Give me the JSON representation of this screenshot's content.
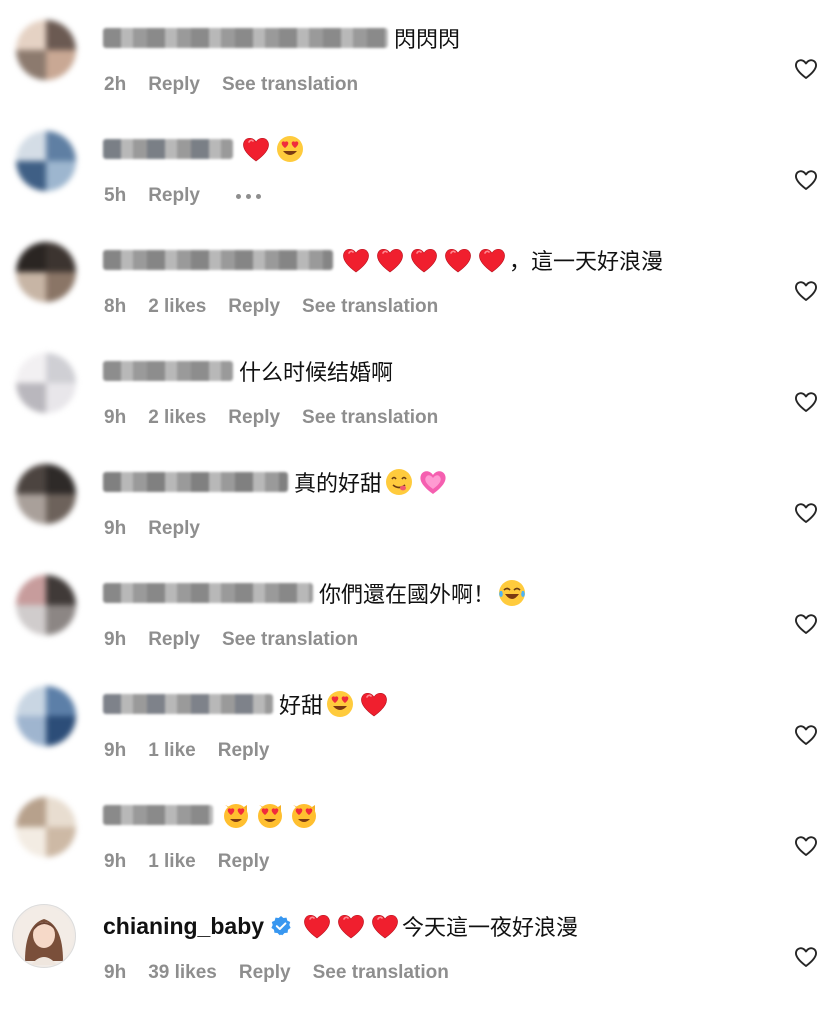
{
  "colors": {
    "meta_gray": "#8e8e8e",
    "text": "#111111",
    "heart_red": "#f01f2e",
    "verified_blue": "#3897f0"
  },
  "comments": [
    {
      "username": "",
      "username_blurred": true,
      "text_before": "閃閃閃",
      "emojis": [],
      "text_after": "",
      "time": "2h",
      "likes": "",
      "reply": "Reply",
      "translate": "See translation",
      "more": false,
      "like_icon": "heart-outline-icon"
    },
    {
      "username": "",
      "username_blurred": true,
      "text_before": "",
      "emojis": [
        "red-heart",
        "heart-eyes-face"
      ],
      "text_after": "",
      "time": "5h",
      "likes": "",
      "reply": "Reply",
      "translate": "",
      "more": true,
      "like_icon": "heart-outline-icon"
    },
    {
      "username": "",
      "username_blurred": true,
      "text_before": "",
      "emojis": [
        "red-heart",
        "red-heart",
        "red-heart",
        "red-heart",
        "red-heart"
      ],
      "text_after": "，這一天好浪漫",
      "time": "8h",
      "likes": "2 likes",
      "reply": "Reply",
      "translate": "See translation",
      "more": false,
      "like_icon": "heart-outline-icon"
    },
    {
      "username": "",
      "username_blurred": true,
      "text_before": "什么时候结婚啊",
      "emojis": [],
      "text_after": "",
      "time": "9h",
      "likes": "2 likes",
      "reply": "Reply",
      "translate": "See translation",
      "more": false,
      "like_icon": "heart-outline-icon"
    },
    {
      "username": "",
      "username_blurred": true,
      "text_before": "真的好甜",
      "emojis": [
        "yum-face",
        "growing-heart"
      ],
      "text_after": "",
      "time": "9h",
      "likes": "",
      "reply": "Reply",
      "translate": "",
      "more": false,
      "like_icon": "heart-outline-icon"
    },
    {
      "username": "",
      "username_blurred": true,
      "text_before": "你們還在國外啊！",
      "emojis": [
        "tears-of-joy-face"
      ],
      "text_after": "",
      "time": "9h",
      "likes": "",
      "reply": "Reply",
      "translate": "See translation",
      "more": false,
      "like_icon": "heart-outline-icon"
    },
    {
      "username": "",
      "username_blurred": true,
      "text_before": "好甜",
      "emojis": [
        "heart-eyes-face",
        "red-heart"
      ],
      "text_after": "",
      "time": "9h",
      "likes": "1 like",
      "reply": "Reply",
      "translate": "",
      "more": false,
      "like_icon": "heart-outline-icon"
    },
    {
      "username": "",
      "username_blurred": true,
      "text_before": "",
      "emojis": [
        "heart-eyes-cat",
        "heart-eyes-cat",
        "heart-eyes-cat"
      ],
      "text_after": "",
      "time": "9h",
      "likes": "1 like",
      "reply": "Reply",
      "translate": "",
      "more": false,
      "like_icon": "heart-outline-icon"
    },
    {
      "username": "chianing_baby",
      "username_blurred": false,
      "verified": true,
      "text_before": "",
      "emojis": [
        "red-heart",
        "red-heart",
        "red-heart"
      ],
      "text_after": "今天這一夜好浪漫",
      "time": "9h",
      "likes": "39 likes",
      "reply": "Reply",
      "translate": "See translation",
      "more": false,
      "like_icon": "heart-outline-icon"
    }
  ]
}
